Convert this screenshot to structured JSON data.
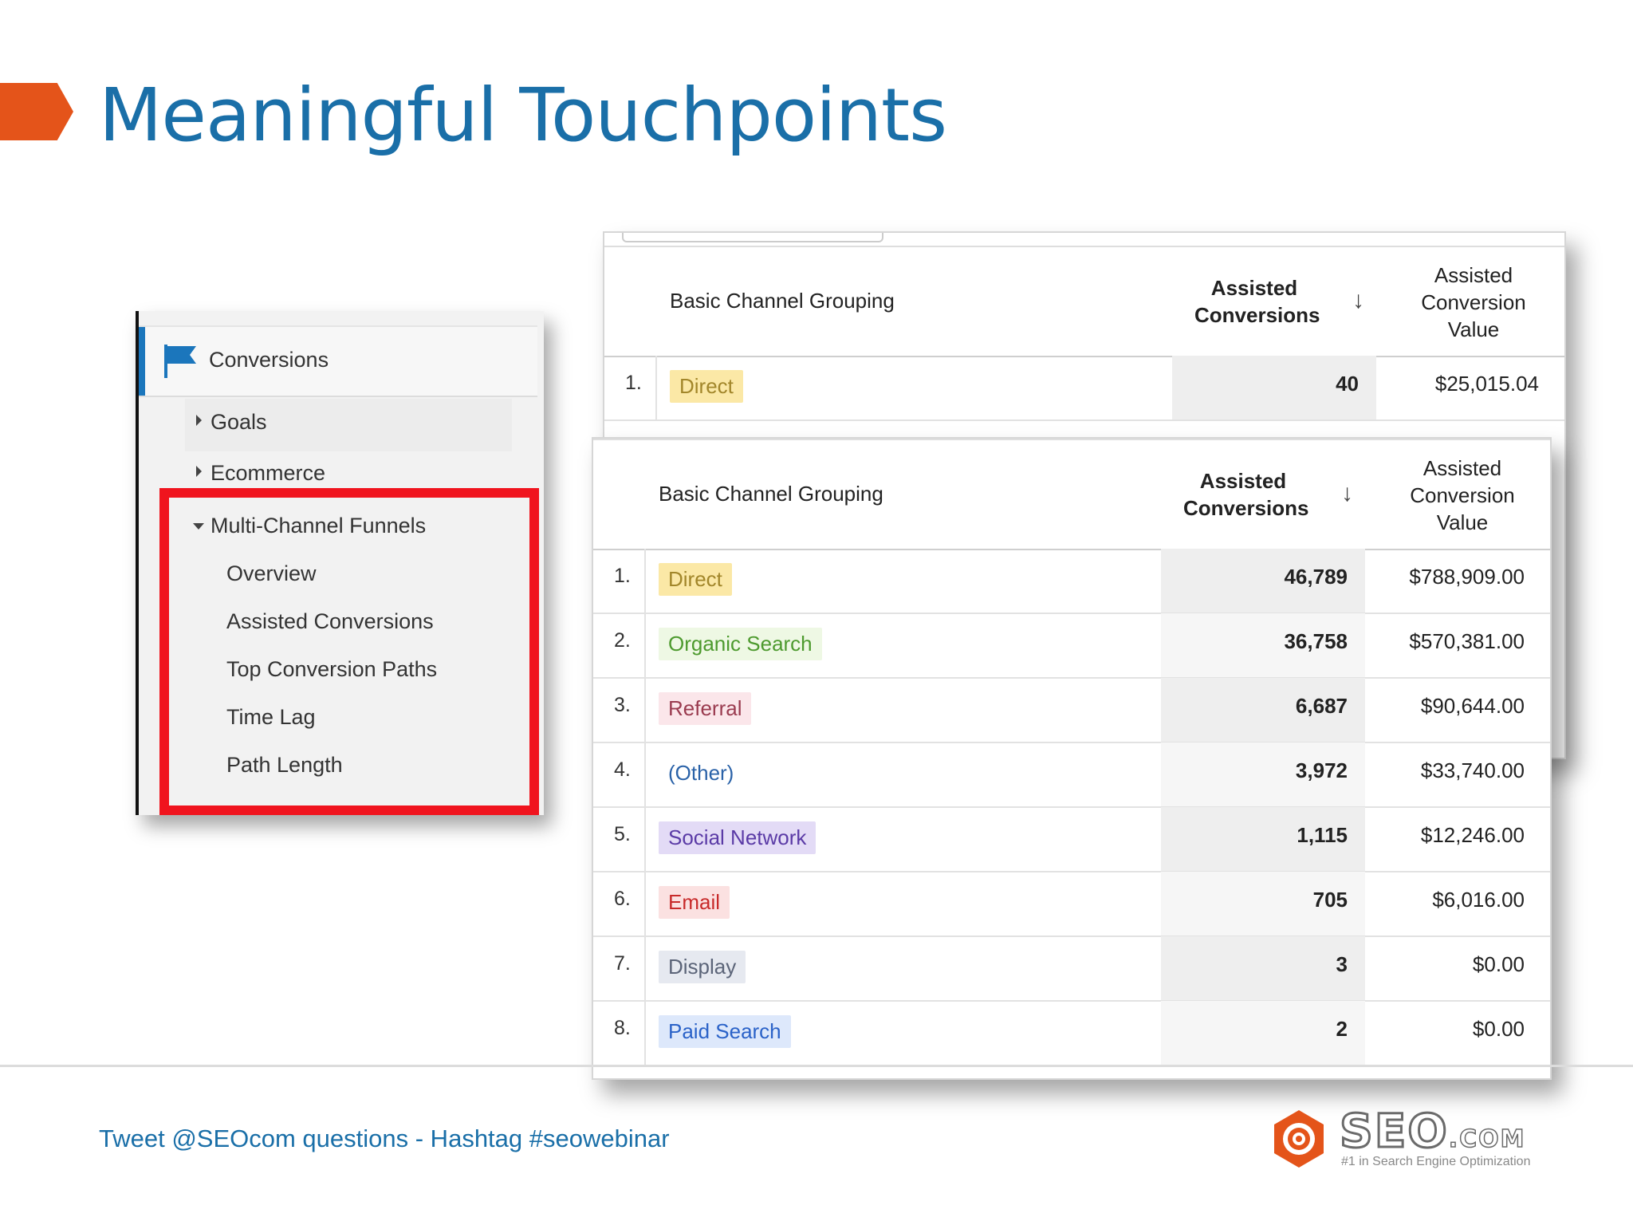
{
  "slide": {
    "title": "Meaningful Touchpoints",
    "footer": "Tweet @SEOcom questions - Hashtag #seowebinar",
    "accent_color": "#e4541a",
    "title_color": "#1a6fa8"
  },
  "nav": {
    "header_icon": "flag-icon",
    "header": "Conversions",
    "goals": "Goals",
    "ecommerce": "Ecommerce",
    "mcf": "Multi-Channel Funnels",
    "items": [
      "Overview",
      "Assisted Conversions",
      "Top Conversion Paths",
      "Time Lag",
      "Path Length"
    ]
  },
  "back_table": {
    "col_dim": "Basic Channel Grouping",
    "col_metric1": [
      "Assisted",
      "Conversions"
    ],
    "col_metric2": [
      "Assisted",
      "Conversion",
      "Value"
    ],
    "rows": [
      {
        "num": "1.",
        "channel": "Direct",
        "assisted": "40",
        "value": "$25,015.04"
      }
    ]
  },
  "front_table": {
    "col_dim": "Basic Channel Grouping",
    "col_metric1": [
      "Assisted",
      "Conversions"
    ],
    "col_metric2": [
      "Assisted",
      "Conversion",
      "Value"
    ],
    "rows": [
      {
        "num": "1.",
        "channel": "Direct",
        "assisted": "46,789",
        "value": "$788,909.00",
        "chip_bg": "#fbe8a6",
        "chip_fg": "#a2862a"
      },
      {
        "num": "2.",
        "channel": "Organic Search",
        "assisted": "36,758",
        "value": "$570,381.00",
        "chip_bg": "#eef8e4",
        "chip_fg": "#4d9a2e"
      },
      {
        "num": "3.",
        "channel": "Referral",
        "assisted": "6,687",
        "value": "$90,644.00",
        "chip_bg": "#fbe6ea",
        "chip_fg": "#9a3b4f"
      },
      {
        "num": "4.",
        "channel": "(Other)",
        "assisted": "3,972",
        "value": "$33,740.00",
        "chip_bg": "#ffffff",
        "chip_fg": "#2a62a8"
      },
      {
        "num": "5.",
        "channel": "Social Network",
        "assisted": "1,115",
        "value": "$12,246.00",
        "chip_bg": "#e3dbf6",
        "chip_fg": "#5a3aa6"
      },
      {
        "num": "6.",
        "channel": "Email",
        "assisted": "705",
        "value": "$6,016.00",
        "chip_bg": "#fbe1e1",
        "chip_fg": "#c82a2a"
      },
      {
        "num": "7.",
        "channel": "Display",
        "assisted": "3",
        "value": "$0.00",
        "chip_bg": "#e6e9f0",
        "chip_fg": "#5b6478"
      },
      {
        "num": "8.",
        "channel": "Paid Search",
        "assisted": "2",
        "value": "$0.00",
        "chip_bg": "#dde8fb",
        "chip_fg": "#2a62c8"
      }
    ]
  },
  "logo": {
    "icon": "seo-target-icon",
    "word": "SEO",
    "suffix": ".COM",
    "tagline": "#1 in Search Engine Optimization"
  }
}
